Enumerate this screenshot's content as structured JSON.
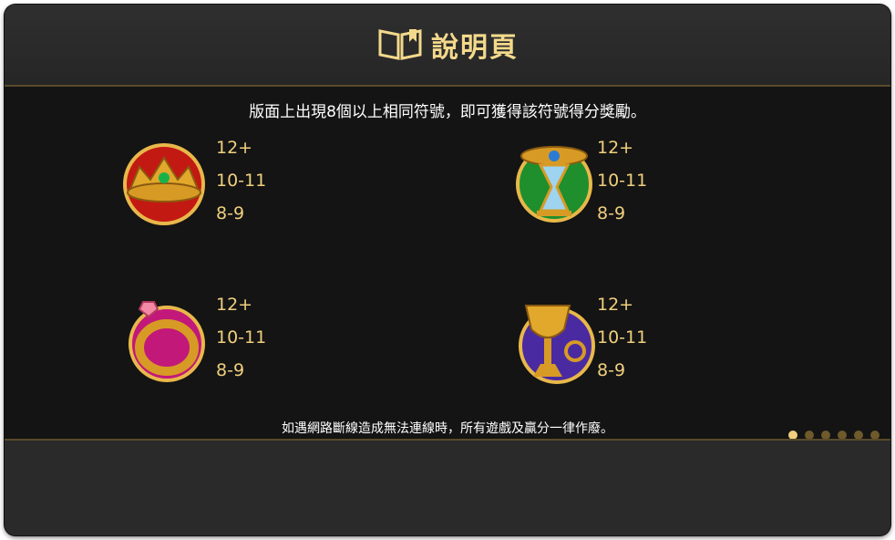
{
  "header": {
    "title": "說明頁",
    "icon": "book-icon"
  },
  "intro": "版面上出現8個以上相同符號，即可獲得該符號得分獎勵。",
  "symbols": [
    {
      "name": "crown",
      "pays": [
        "12+",
        "10-11",
        "8-9"
      ]
    },
    {
      "name": "hourglass",
      "pays": [
        "12+",
        "10-11",
        "8-9"
      ]
    },
    {
      "name": "ring",
      "pays": [
        "12+",
        "10-11",
        "8-9"
      ]
    },
    {
      "name": "chalice",
      "pays": [
        "12+",
        "10-11",
        "8-9"
      ]
    }
  ],
  "note": "如遇網路斷線造成無法連線時，所有遊戲及贏分一律作廢。",
  "pagination": {
    "total": 6,
    "active": 1
  },
  "colors": {
    "gold": "#f0cf7e",
    "red": "#c21a12",
    "green": "#1e8f2c",
    "magenta": "#c2187a",
    "purple": "#4a2aa0"
  }
}
